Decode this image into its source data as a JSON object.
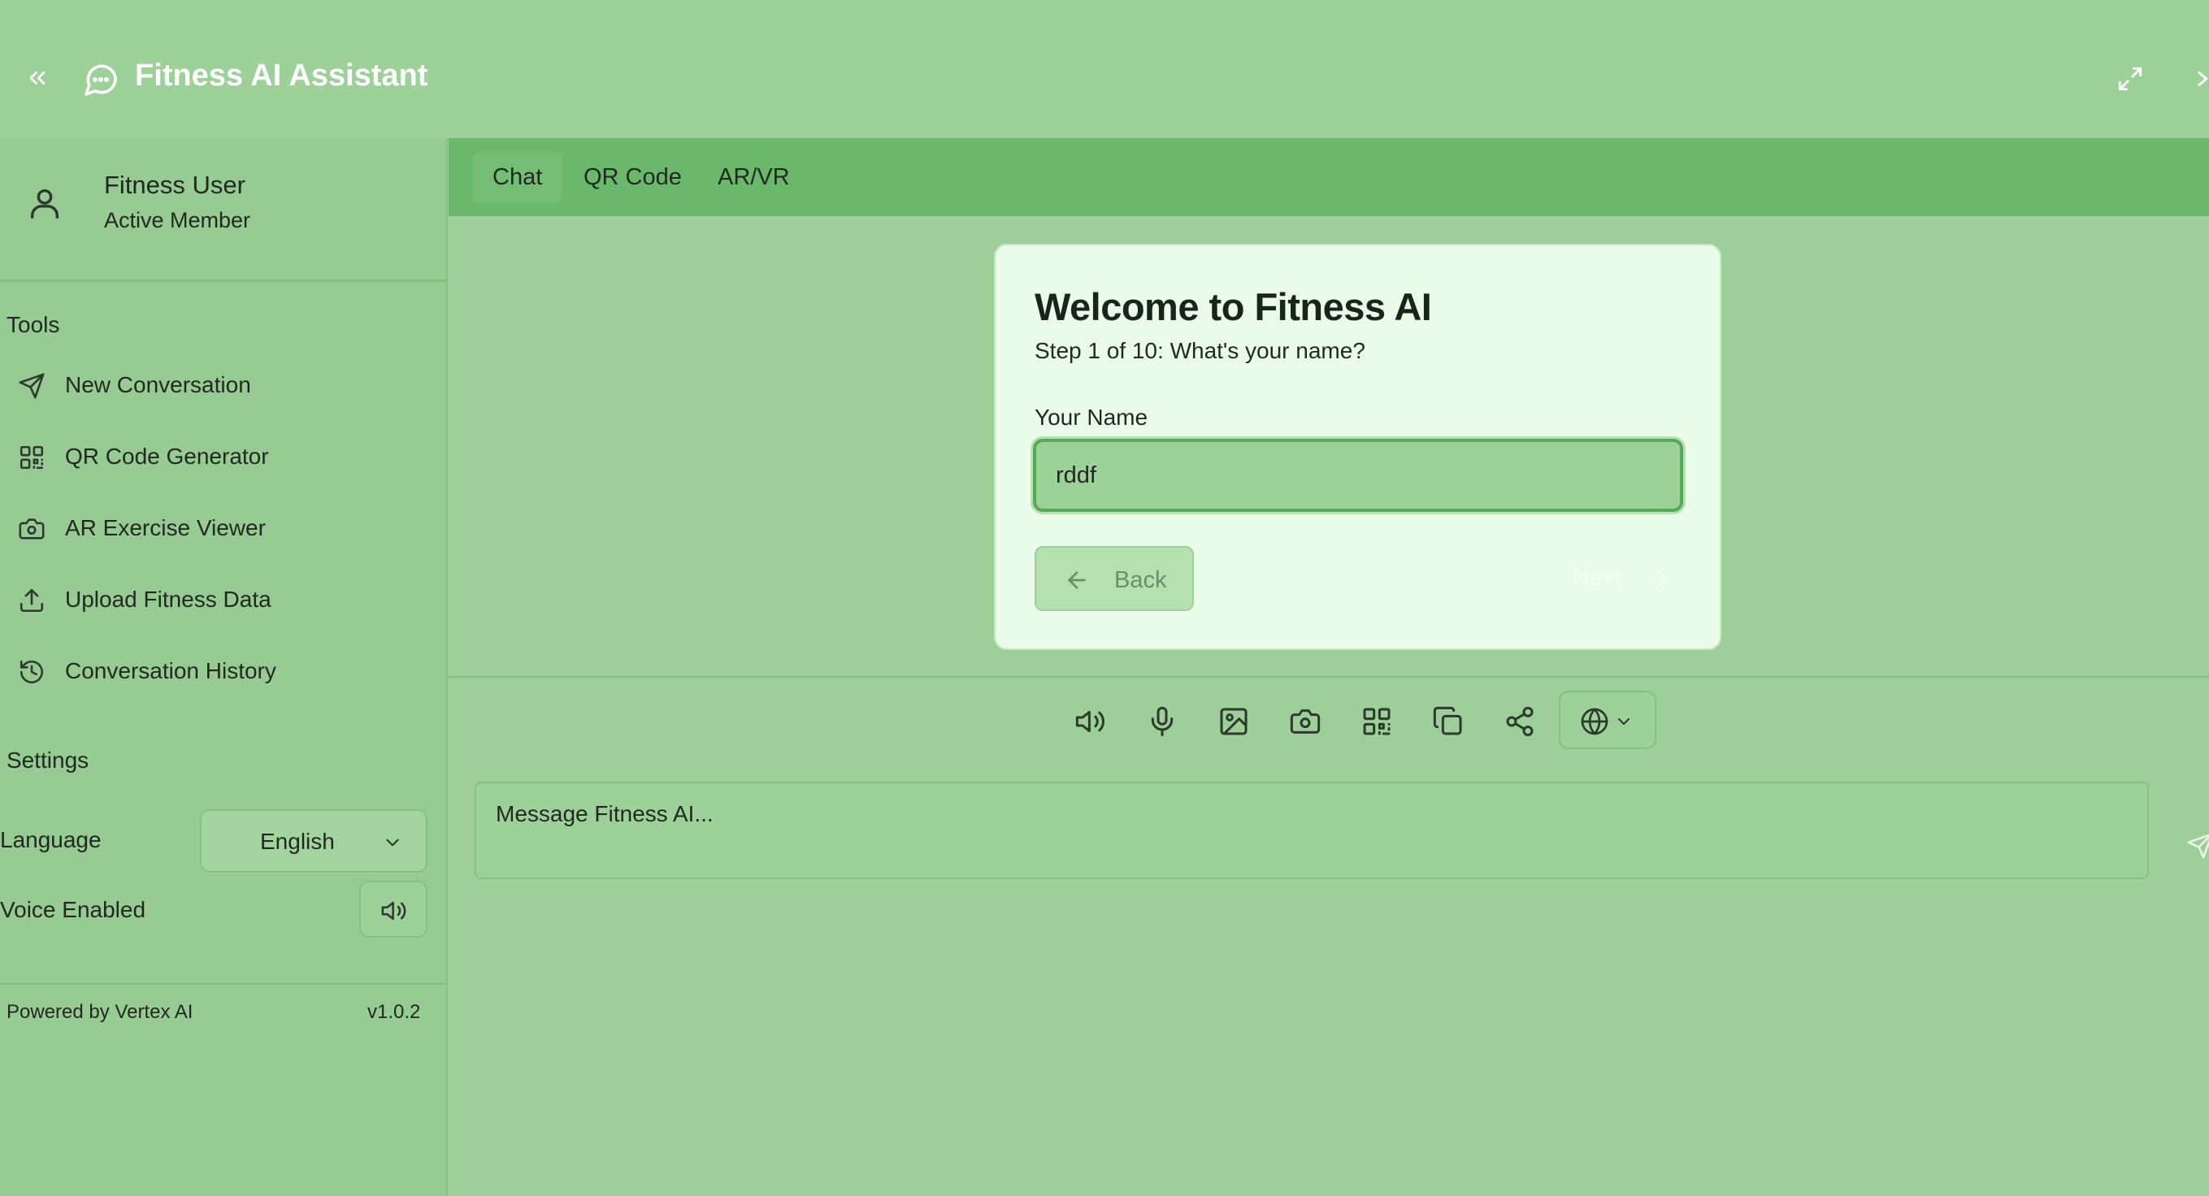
{
  "header": {
    "title": "Fitness AI Assistant",
    "icons": [
      "chevrons-left-icon",
      "message-circle-icon",
      "maximize-icon",
      "chevron-right-icon"
    ]
  },
  "sidebar": {
    "user": {
      "name": "Fitness User",
      "status": "Active Member"
    },
    "tools_title": "Tools",
    "tools": [
      {
        "label": "New Conversation",
        "icon": "send-icon"
      },
      {
        "label": "QR Code Generator",
        "icon": "qr-code-icon"
      },
      {
        "label": "AR Exercise Viewer",
        "icon": "camera-icon"
      },
      {
        "label": "Upload Fitness Data",
        "icon": "upload-icon"
      },
      {
        "label": "Conversation History",
        "icon": "history-icon"
      }
    ],
    "settings_title": "Settings",
    "settings": {
      "language_label": "Language",
      "language_value": "English",
      "voice_label": "Voice Enabled"
    },
    "footer": {
      "powered_by": "Powered by Vertex AI",
      "version": "v1.0.2"
    }
  },
  "tabs": [
    {
      "label": "Chat",
      "active": true
    },
    {
      "label": "QR Code",
      "active": false
    },
    {
      "label": "AR/VR",
      "active": false
    }
  ],
  "onboarding": {
    "title": "Welcome to Fitness AI",
    "step": "Step 1 of 10: What's your name?",
    "field_label": "Your Name",
    "field_value": "rddf",
    "back_label": "Back",
    "next_label": "Next"
  },
  "toolbar": {
    "icons": [
      "volume-icon",
      "microphone-icon",
      "image-icon",
      "camera-icon",
      "qr-code-icon",
      "copy-icon",
      "share-icon",
      "globe-icon"
    ]
  },
  "composer": {
    "placeholder": "Message Fitness AI..."
  },
  "colors": {
    "background": "#9ecf9a",
    "tabbar": "#6bb86d",
    "card": "#ebfbe9",
    "input_focus": "#55a958",
    "header_text": "#ffffff"
  }
}
